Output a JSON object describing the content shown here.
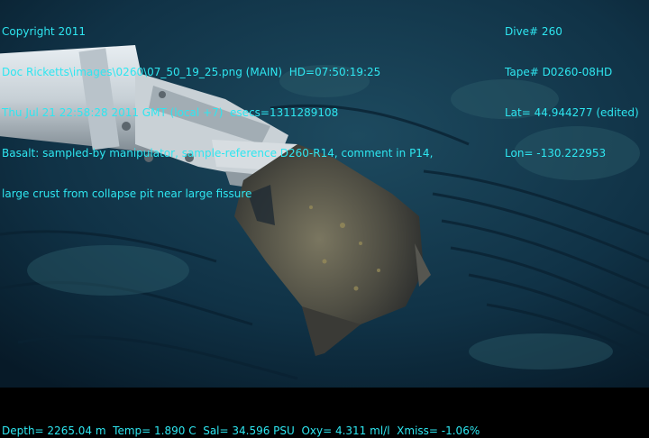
{
  "overlay": {
    "top_left": [
      "Copyright 2011",
      "Doc Ricketts\\images\\0260\\07_50_19_25.png (MAIN)  HD=07:50:19:25",
      "Thu Jul 21 22:58:28 2011 GMT (local +7)  esecs=1311289108",
      "Basalt: sampled-by manipulator, sample-reference D260-R14, comment in P14,",
      "large crust from collapse pit near large fissure"
    ],
    "top_right": [
      "Dive# 260",
      "Tape# D0260-08HD",
      "Lat= 44.944277 (edited)",
      "Lon= -130.222953"
    ],
    "bottom": "Depth= 2265.04 m  Temp= 1.890 C  Sal= 34.596 PSU  Oxy= 4.311 ml/l  Xmiss= -1.06%"
  },
  "colors": {
    "overlay_text": "#2ee6f0",
    "water": "#0d2a3c",
    "letterbox": "#000000"
  }
}
